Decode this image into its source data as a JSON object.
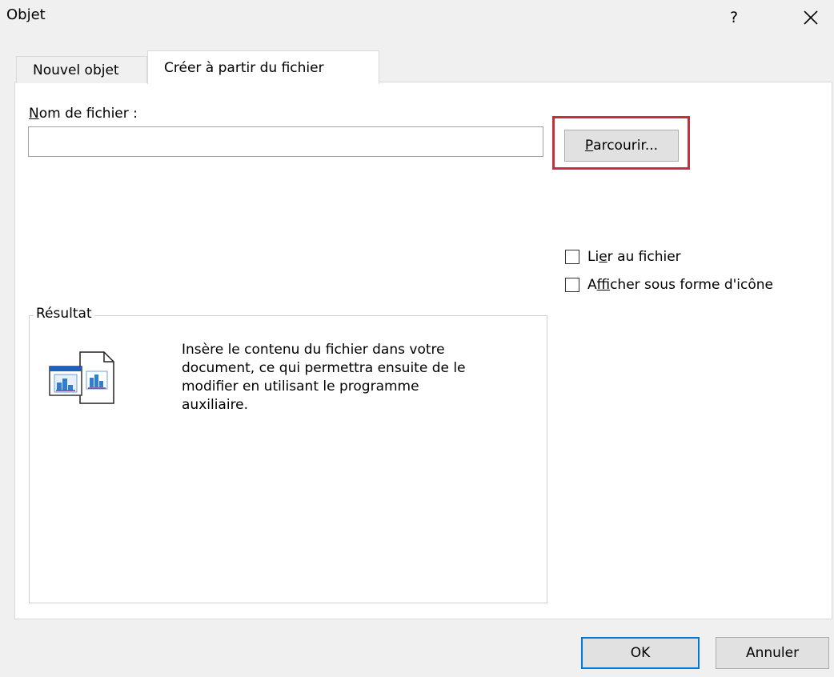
{
  "window": {
    "title": "Objet",
    "help_label": "?",
    "close_icon": "close-icon"
  },
  "tabs": [
    {
      "label": "Nouvel objet",
      "active": false
    },
    {
      "label": "Créer à partir du fichier",
      "active": true
    }
  ],
  "file": {
    "label_mnemonic": "N",
    "label_rest": "om de fichier :",
    "value": "",
    "browse_mnemonic": "P",
    "browse_rest": "arcourir...",
    "highlight_color": "#c4303b"
  },
  "options": {
    "link": {
      "pre": "Li",
      "mnemonic": "e",
      "post": "r au fichier",
      "checked": false
    },
    "icon": {
      "pre": "A",
      "mnemonic": "f",
      "post": "ficher sous forme d'icône",
      "checked": false
    }
  },
  "result": {
    "legend": "Résultat",
    "lines": [
      "Insère le contenu du fichier dans votre",
      "document, ce qui permettra ensuite de le",
      "modifier en utilisant le programme",
      "auxiliaire."
    ],
    "icon": "embedded-document-icon"
  },
  "footer": {
    "ok_label": "OK",
    "cancel_label": "Annuler",
    "ok_border_color": "#0078d7"
  }
}
